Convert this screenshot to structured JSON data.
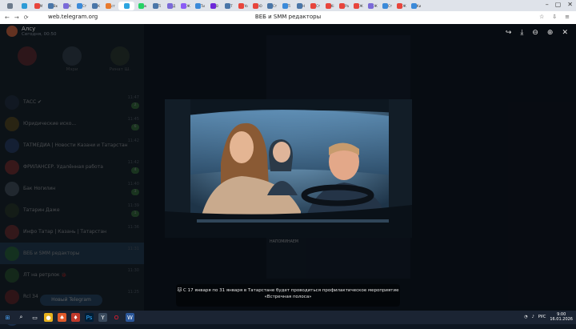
{
  "browser": {
    "url": "web.telegram.org",
    "page_title": "ВЕБ и SMM редакторы",
    "tabs": [
      {
        "label": "",
        "color": "#6b7a8c"
      },
      {
        "label": "",
        "color": "#2d9bd6"
      },
      {
        "label": "M",
        "color": "#e8453c"
      },
      {
        "label": "Вк",
        "color": "#4a76a8"
      },
      {
        "label": "К",
        "color": "#7a6ad8"
      },
      {
        "label": "Ст",
        "color": "#3b8ad9"
      },
      {
        "label": "К",
        "color": "#4a76a8"
      },
      {
        "label": "ст",
        "color": "#e87a2e"
      },
      {
        "label": "",
        "color": "#2ca5e0"
      },
      {
        "label": "w",
        "color": "#25d366"
      },
      {
        "label": "Тi",
        "color": "#4a76a8"
      },
      {
        "label": "Д",
        "color": "#7a6ad8"
      },
      {
        "label": "Ж",
        "color": "#8b5cf6"
      },
      {
        "label": "Ти",
        "color": "#3b8ad9"
      },
      {
        "label": "В",
        "color": "#6d28d9"
      },
      {
        "label": "Т",
        "color": "#4a76a8"
      },
      {
        "label": "Yo",
        "color": "#e8453c"
      },
      {
        "label": "Ю",
        "color": "#e8453c"
      },
      {
        "label": "Ст",
        "color": "#4a76a8"
      },
      {
        "label": "Тi",
        "color": "#3b8ad9"
      },
      {
        "label": "Н",
        "color": "#4a76a8"
      },
      {
        "label": "Ст",
        "color": "#e8453c"
      },
      {
        "label": "Кi",
        "color": "#e8453c"
      },
      {
        "label": "Ра",
        "color": "#e8453c"
      },
      {
        "label": "Ж",
        "color": "#e8453c"
      },
      {
        "label": "Ж",
        "color": "#7a6ad8"
      },
      {
        "label": "Ст",
        "color": "#3b8ad9"
      },
      {
        "label": "Ж",
        "color": "#e8453c"
      },
      {
        "label": "Ки",
        "color": "#3b8ad9"
      }
    ]
  },
  "telegram": {
    "profile": {
      "name": "Алсу",
      "time": "Сегодня, 00:50"
    },
    "stories": [
      {
        "label": "",
        "color": "#c23a3a"
      },
      {
        "label": "Мэри",
        "color": "#5a6b7d"
      },
      {
        "label": "Ринат Ш.",
        "color": "#4a5a3d"
      }
    ],
    "chats": [
      {
        "title": "ТАСС ✔",
        "preview": "",
        "time": "11:47",
        "badge": "2",
        "color": "#2a3a55"
      },
      {
        "title": "Юридические иско...",
        "preview": "",
        "time": "11:45",
        "badge": "6",
        "color": "#8a6a1d"
      },
      {
        "title": "ТАТМЕДИА | Новости Казани и Татарстана",
        "preview": "",
        "time": "11:42",
        "badge": "",
        "color": "#3a5a9a"
      },
      {
        "title": "ФРИЛАНСЕР. Удалённая работа",
        "preview": "",
        "time": "11:42",
        "badge": "4",
        "color": "#c23a3a"
      },
      {
        "title": "Бак Ногилин",
        "preview": "",
        "time": "11:40",
        "badge": "3",
        "color": "#6b7a8c"
      },
      {
        "title": "Татарин Даже",
        "preview": "",
        "time": "11:39",
        "badge": "1",
        "color": "#3a4a2d"
      },
      {
        "title": "Инфо Татар | Казань | Татарстан",
        "preview": "",
        "time": "11:36",
        "badge": "",
        "color": "#b43a3a"
      },
      {
        "title": "ВЕБ и SMM редакторы",
        "preview": "",
        "time": "11:31",
        "badge": "",
        "color": "#3aa04a"
      },
      {
        "title": "ЛТ на ретрлок 🐞",
        "preview": "",
        "time": "11:30",
        "badge": "",
        "color": "#3a7a3a"
      },
      {
        "title": "Rcl 34",
        "preview": "",
        "time": "11:25",
        "badge": "",
        "color": "#a02a2a"
      },
      {
        "title": "ГОСАВТОИНСПЕКЦИЯ | ТАТАРСТАН",
        "preview": "",
        "time": "11:20",
        "badge": "",
        "color": "#2a4a7a"
      }
    ],
    "new_chat_label": "Новый Telegram",
    "message_top": "",
    "message_bottom_title": "НАПОМИНАЕМ",
    "message_bottom_link": "",
    "caption": "🐱 С 17 января по 31 января в Татарстане будет проводиться профилактическое мероприятие «Встречная полоса»"
  },
  "taskbar": {
    "lang": "РУС",
    "time": "9:00",
    "date": "16.01.2026"
  }
}
